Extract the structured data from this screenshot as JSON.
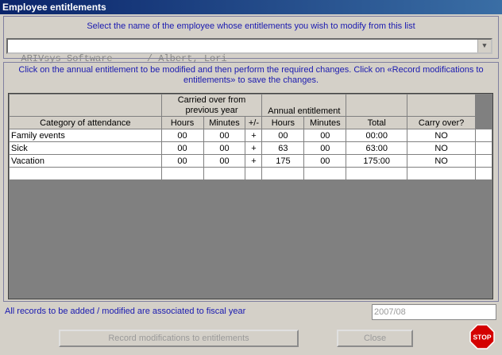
{
  "window": {
    "title": "Employee entitlements"
  },
  "select": {
    "instruction": "Select the name of the employee whose entitlements you wish to modify from this list",
    "value": "ARIVsys Software      / Albert, Lori"
  },
  "grid_instruction": "Click on the annual entitlement to be modified and then perform the required changes. Click on «Record modifications to entitlements» to save the changes.",
  "table": {
    "group_carried": "Carried over from previous year",
    "group_annual": "Annual entitlement",
    "headers": {
      "category": "Category of attendance",
      "hours": "Hours",
      "minutes": "Minutes",
      "sign": "+/-",
      "annual_hours": "Hours",
      "annual_minutes": "Minutes",
      "total": "Total",
      "carry": "Carry over?"
    },
    "rows": [
      {
        "category": "Family events",
        "c_hours": "00",
        "c_minutes": "00",
        "sign": "+",
        "a_hours": "00",
        "a_minutes": "00",
        "total": "00:00",
        "carry": "NO"
      },
      {
        "category": "Sick",
        "c_hours": "00",
        "c_minutes": "00",
        "sign": "+",
        "a_hours": "63",
        "a_minutes": "00",
        "total": "63:00",
        "carry": "NO"
      },
      {
        "category": "Vacation",
        "c_hours": "00",
        "c_minutes": "00",
        "sign": "+",
        "a_hours": "175",
        "a_minutes": "00",
        "total": "175:00",
        "carry": "NO"
      }
    ]
  },
  "fiscal": {
    "label": "All records to be added / modified are associated to fiscal year",
    "value": "2007/08"
  },
  "buttons": {
    "record": "Record modifications to entitlements",
    "close": "Close",
    "stop": "STOP"
  }
}
